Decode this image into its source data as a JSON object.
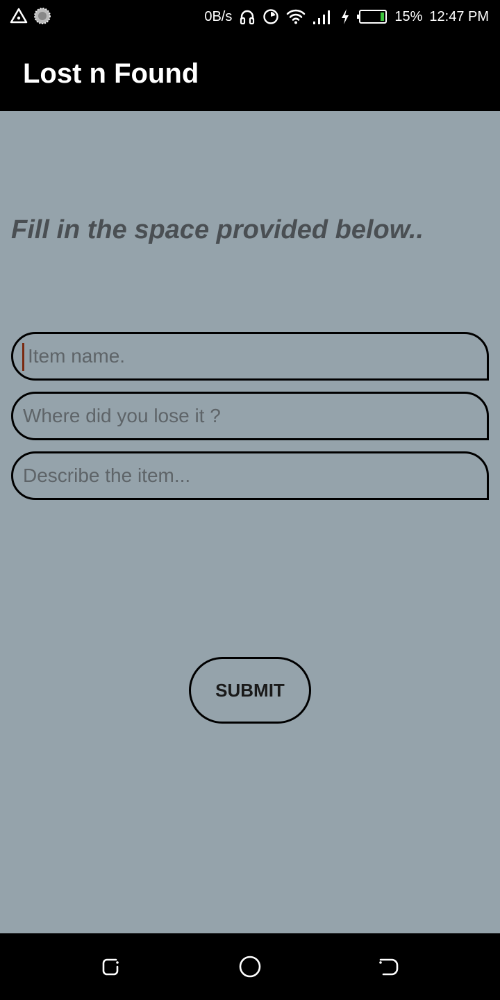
{
  "status_bar": {
    "net_speed": "0B/s",
    "battery_percent": "15%",
    "time": "12:47 PM",
    "icons": [
      "alert-triangle-icon",
      "gear-notification-icon",
      "headphones-icon",
      "data-saver-icon",
      "wifi-icon",
      "signal-icon",
      "charging-icon",
      "battery-icon"
    ]
  },
  "app_bar": {
    "title": "Lost n Found"
  },
  "form": {
    "instruction": "Fill in the space provided below..",
    "item_name_placeholder": "Item name.",
    "location_placeholder": "Where did you lose it ?",
    "description_placeholder": "Describe the item...",
    "submit_label": "SUBMIT"
  },
  "nav_bar": {
    "icons": [
      "recent-apps-icon",
      "home-icon",
      "back-icon"
    ]
  },
  "colors": {
    "background": "#95a3ab",
    "bars": "#000000",
    "instruction_text": "#4a4f53",
    "caret": "#7a2a10"
  }
}
